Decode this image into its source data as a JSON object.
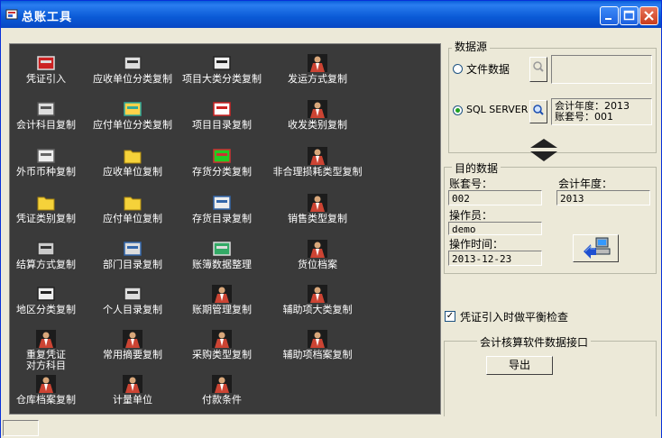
{
  "window": {
    "title": "总账工具"
  },
  "tools": [
    {
      "label": "凭证引入",
      "icon": "stamp-icon"
    },
    {
      "label": "应收单位分类复制",
      "icon": "cabinet-icon"
    },
    {
      "label": "项目大类分类复制",
      "icon": "vehicle-icon"
    },
    {
      "label": "发运方式复制",
      "icon": "person-icon"
    },
    {
      "label": "会计科目复制",
      "icon": "ledger-icon"
    },
    {
      "label": "应付单位分类复制",
      "icon": "arrows-icon"
    },
    {
      "label": "项目目录复制",
      "icon": "document-icon"
    },
    {
      "label": "收发类别复制",
      "icon": "person-icon"
    },
    {
      "label": "外币币种复制",
      "icon": "printer-icon"
    },
    {
      "label": "应收单位复制",
      "icon": "folder-icon"
    },
    {
      "label": "存货分类复制",
      "icon": "chart-icon"
    },
    {
      "label": "非合理损耗类型复制",
      "icon": "person-icon"
    },
    {
      "label": "凭证类别复制",
      "icon": "folder-icon"
    },
    {
      "label": "应付单位复制",
      "icon": "folder-icon"
    },
    {
      "label": "存货目录复制",
      "icon": "book-icon"
    },
    {
      "label": "销售类型复制",
      "icon": "person-icon"
    },
    {
      "label": "结算方式复制",
      "icon": "calculator-icon"
    },
    {
      "label": "部门目录复制",
      "icon": "grid-icon"
    },
    {
      "label": "账簿数据整理",
      "icon": "network-icon"
    },
    {
      "label": "货位档案",
      "icon": "person-icon"
    },
    {
      "label": "地区分类复制",
      "icon": "vehicle-icon"
    },
    {
      "label": "个人目录复制",
      "icon": "cabinet-icon"
    },
    {
      "label": "账期管理复制",
      "icon": "person-icon"
    },
    {
      "label": "辅助项大类复制",
      "icon": "person-icon"
    },
    {
      "label": "重复凭证\n对方科目",
      "icon": "person-icon"
    },
    {
      "label": "常用摘要复制",
      "icon": "person-icon"
    },
    {
      "label": "采购类型复制",
      "icon": "person-icon"
    },
    {
      "label": "辅助项档案复制",
      "icon": "person-icon"
    },
    {
      "label": "仓库档案复制",
      "icon": "person-icon"
    },
    {
      "label": "计量单位",
      "icon": "person-icon"
    },
    {
      "label": "付款条件",
      "icon": "person-icon"
    }
  ],
  "source": {
    "title": "数据源",
    "file_label": "文件数据",
    "file_value": "",
    "sql_label": "SQL SERVER",
    "sql_info_line1": "会计年度：2013",
    "sql_info_line2": "账套号：001"
  },
  "target": {
    "title": "目的数据",
    "account_label": "账套号：",
    "account_value": "002",
    "year_label": "会计年度：",
    "year_value": "2013",
    "operator_label": "操作员：",
    "operator_value": "demo",
    "time_label": "操作时间：",
    "time_value": "2013-12-23"
  },
  "balance_check_label": "凭证引入时做平衡检查",
  "export": {
    "title": "会计核算软件数据接口",
    "button_label": "导出"
  }
}
